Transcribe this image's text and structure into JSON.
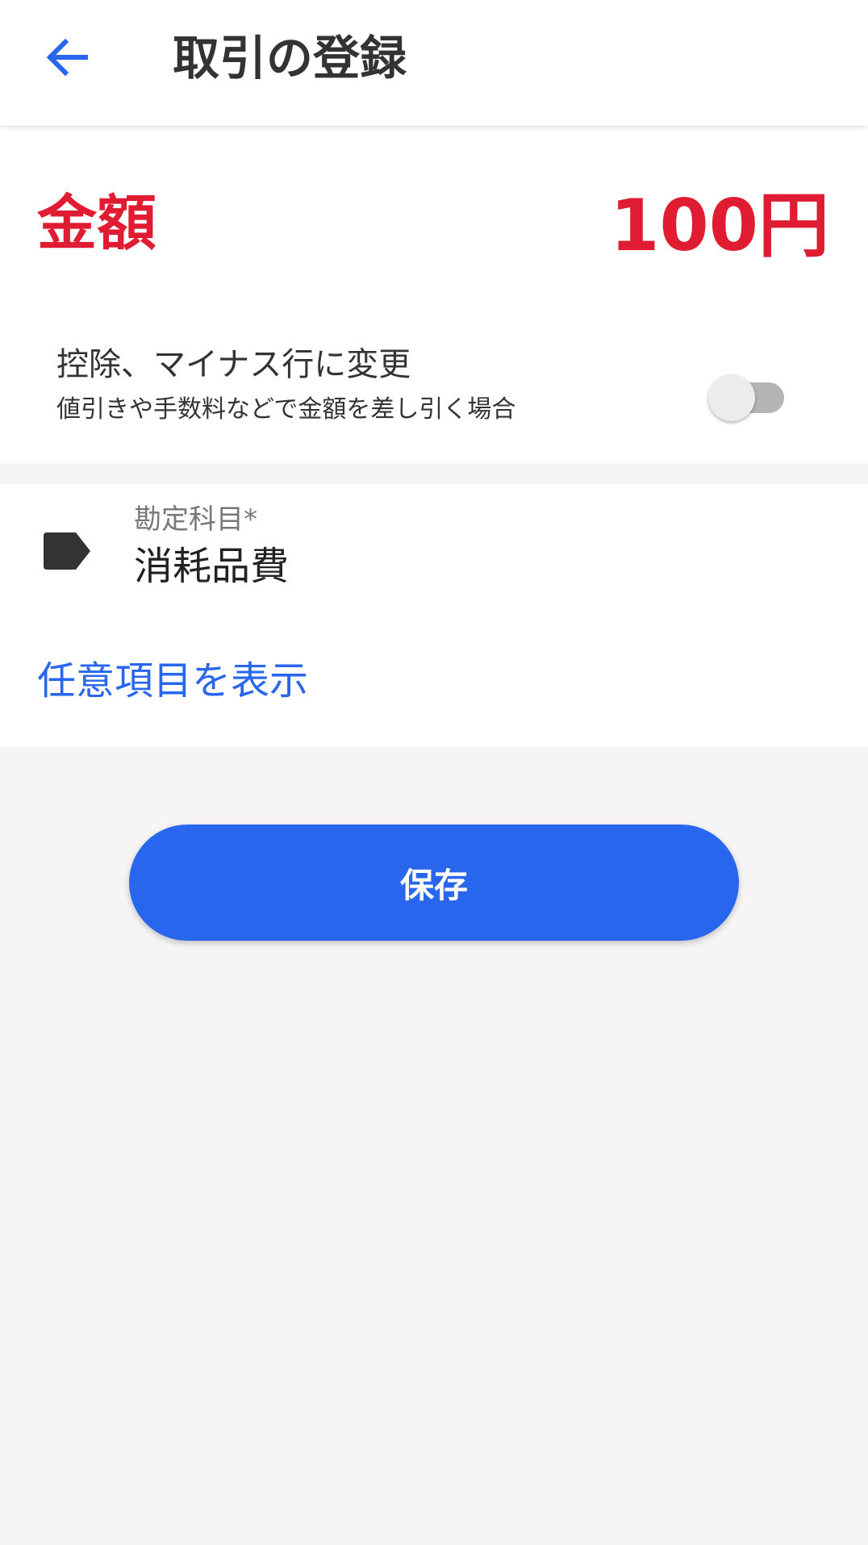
{
  "colors": {
    "accent": "#2866ee",
    "amount": "#e01c32"
  },
  "appbar": {
    "back_icon": "arrow-left-icon",
    "title": "取引の登録"
  },
  "amount": {
    "label": "金額",
    "value": "100円"
  },
  "deduction": {
    "title": "控除、マイナス行に変更",
    "subtitle": "値引きや手数料などで金額を差し引く場合",
    "toggle_on": false
  },
  "account": {
    "icon": "tag-icon",
    "label": "勘定科目*",
    "value": "消耗品費"
  },
  "optional": {
    "link_label": "任意項目を表示"
  },
  "actions": {
    "save_label": "保存"
  }
}
